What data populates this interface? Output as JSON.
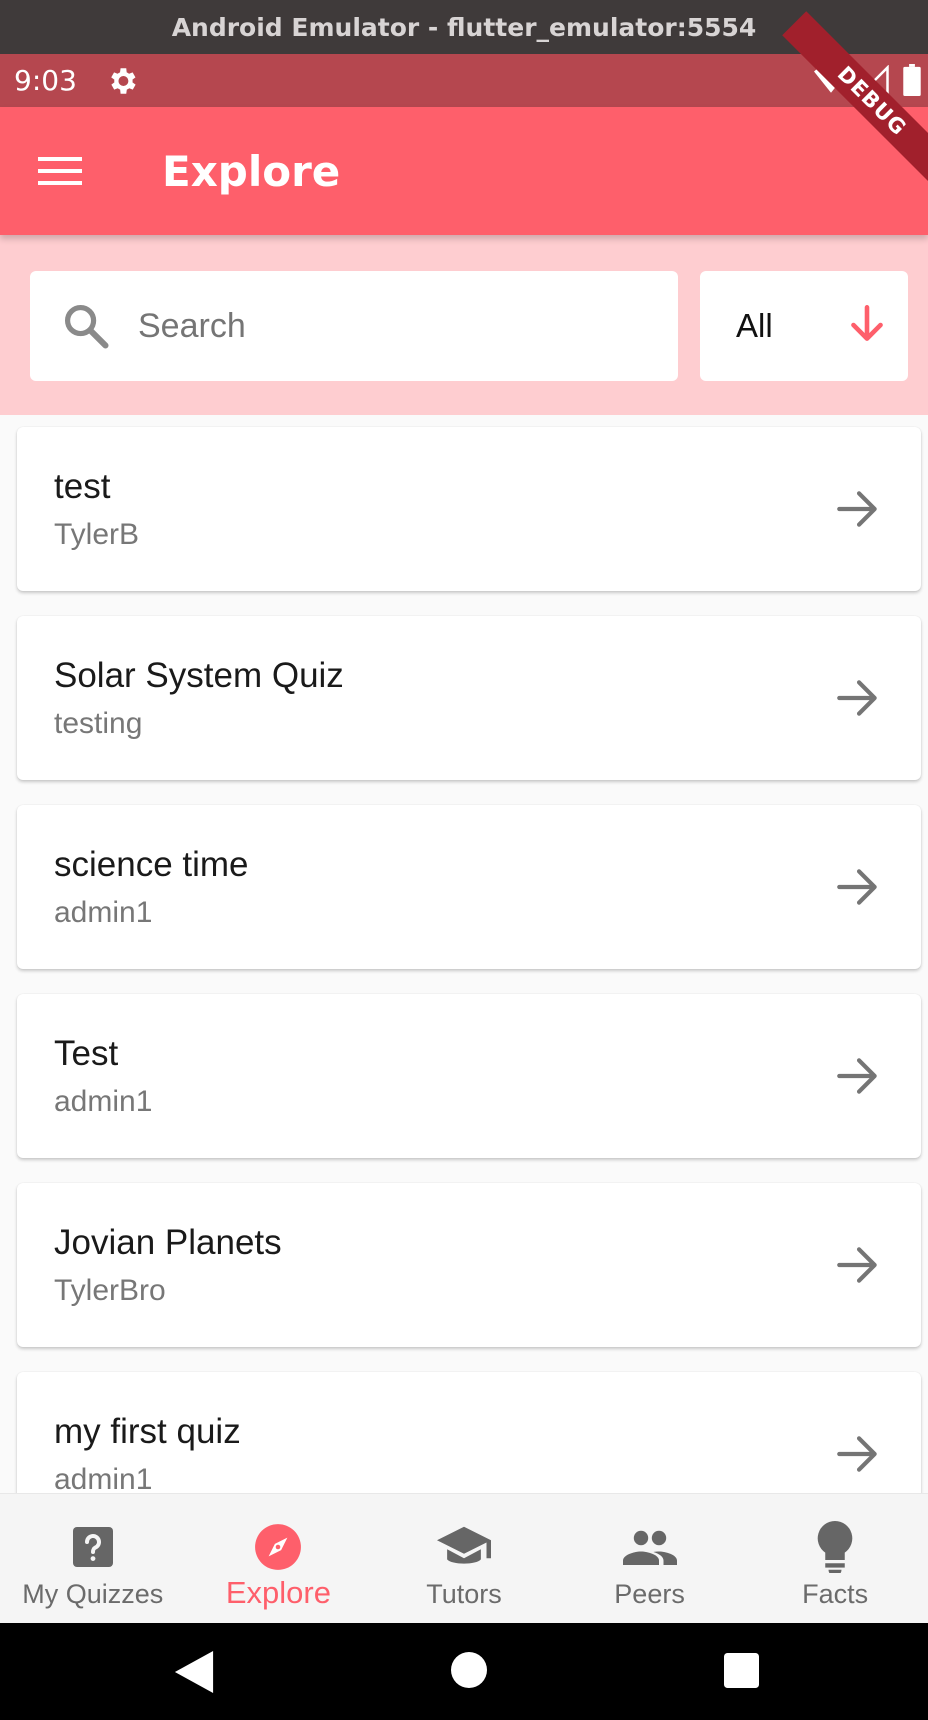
{
  "window": {
    "title": "Android Emulator - flutter_emulator:5554"
  },
  "status_bar": {
    "time": "9:03",
    "icons": [
      "gear-icon",
      "wifi-icon",
      "signal-icon",
      "battery-icon"
    ]
  },
  "debug_banner": "DEBUG",
  "app_bar": {
    "title": "Explore",
    "menu_icon": "menu-icon"
  },
  "search": {
    "placeholder": "Search",
    "value": ""
  },
  "filter": {
    "selected": "All"
  },
  "quizzes": [
    {
      "title": "test",
      "author": "TylerB"
    },
    {
      "title": "Solar System Quiz",
      "author": "testing"
    },
    {
      "title": "science time",
      "author": "admin1"
    },
    {
      "title": "Test",
      "author": "admin1"
    },
    {
      "title": "Jovian Planets",
      "author": "TylerBro"
    },
    {
      "title": "my first quiz",
      "author": "admin1"
    }
  ],
  "bottom_nav": [
    {
      "label": "My Quizzes",
      "icon": "help-icon",
      "active": false
    },
    {
      "label": "Explore",
      "icon": "compass-icon",
      "active": true
    },
    {
      "label": "Tutors",
      "icon": "school-icon",
      "active": false
    },
    {
      "label": "Peers",
      "icon": "people-icon",
      "active": false
    },
    {
      "label": "Facts",
      "icon": "lightbulb-icon",
      "active": false
    }
  ],
  "colors": {
    "primary": "#fe5f6b",
    "status_bar": "#b5474f",
    "search_bg": "#fecdd0",
    "inactive": "#6b6b6b"
  }
}
